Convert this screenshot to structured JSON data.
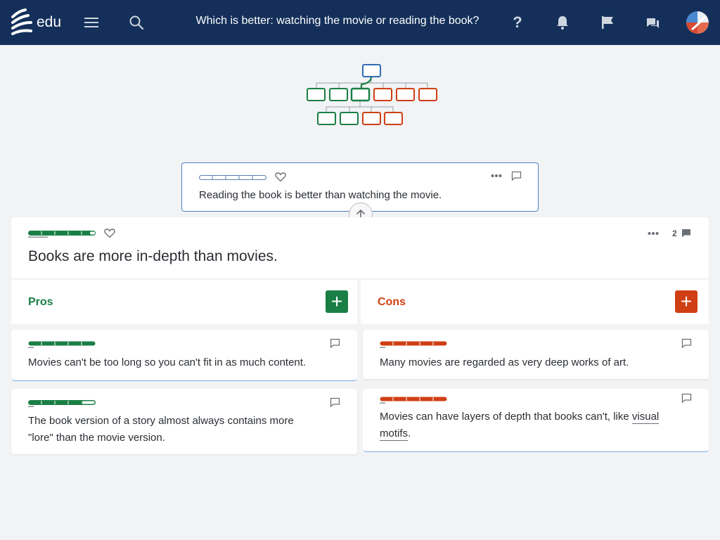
{
  "header": {
    "brand": "edu",
    "title": "Which is better: watching the movie or reading the book?",
    "icons": [
      "logo-icon",
      "menu-icon",
      "search-icon",
      "help-icon",
      "bell-icon",
      "flag-icon",
      "chat-icon",
      "avatar"
    ],
    "help_glyph": "?"
  },
  "parent_claim": {
    "text": "Reading the book is better than watching the movie."
  },
  "main_claim": {
    "text": "Books are more in-depth than movies.",
    "comment_count": "2"
  },
  "pros": {
    "label": "Pros",
    "add_glyph": "+",
    "items": [
      {
        "text": "Movies can't be too long so you can't fit in as much content."
      },
      {
        "text_line1": "The book version of a story almost always contains more",
        "text_line2": "\"lore\" than the movie version."
      }
    ]
  },
  "cons": {
    "label": "Cons",
    "add_glyph": "+",
    "items": [
      {
        "text": "Many movies are regarded as very deep works of art."
      },
      {
        "text_line1a": "Movies can have layers of depth that books can't, like ",
        "text_line1b": "visual",
        "text_line2": "motifs",
        "text_line2_end": "."
      }
    ]
  },
  "colors": {
    "navbar": "#14305a",
    "pro": "#1a7f45",
    "con": "#cf3f13",
    "link": "#2f6db3"
  }
}
